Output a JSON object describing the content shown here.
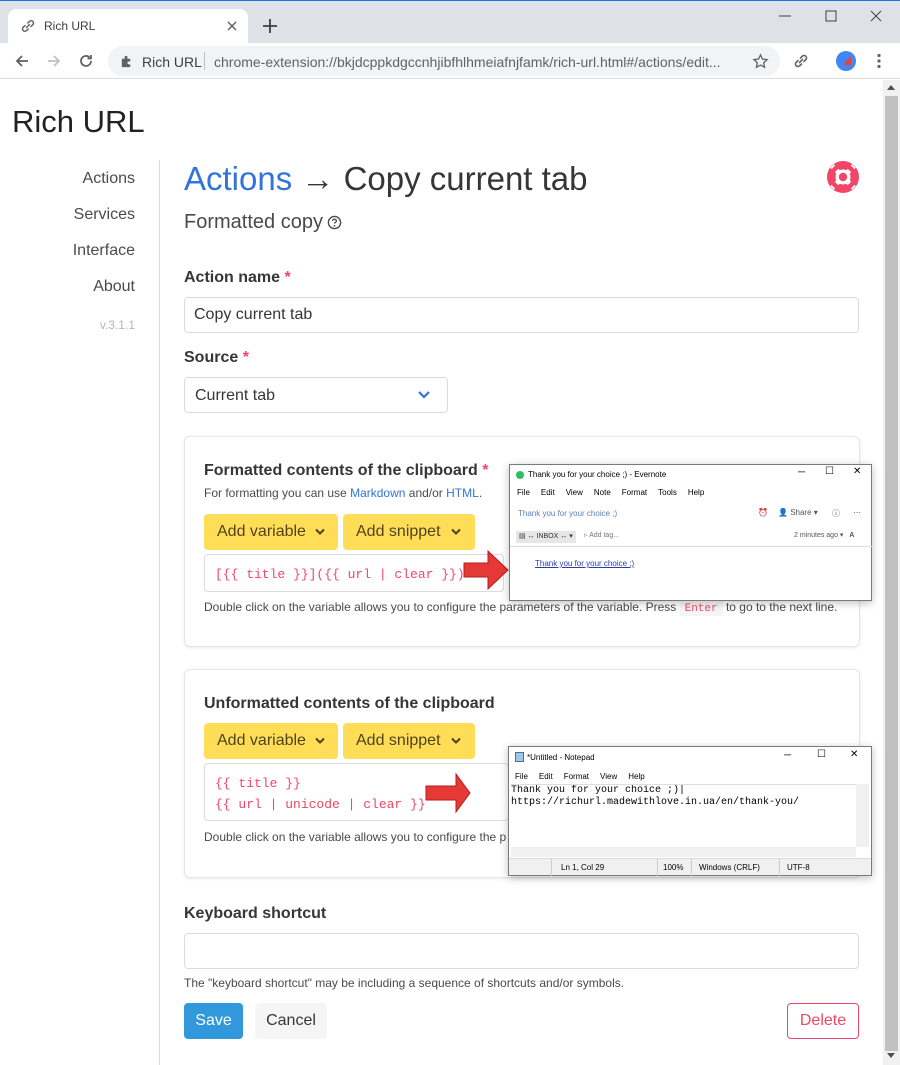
{
  "browser": {
    "tab_title": "Rich URL",
    "omnibox_name": "Rich URL",
    "omnibox_url": "chrome-extension://bkjdcppkdgccnhjibfhlhmeiafnjfamk/rich-url.html#/actions/edit..."
  },
  "brand": "Rich URL",
  "sidebar": {
    "items": [
      {
        "label": "Actions"
      },
      {
        "label": "Services"
      },
      {
        "label": "Interface"
      },
      {
        "label": "About"
      }
    ],
    "version": "v.3.1.1"
  },
  "header": {
    "title_link": "Actions",
    "title_arrow": " → ",
    "title_rest": "Copy current tab",
    "subtitle": "Formatted copy"
  },
  "form": {
    "action_name_label": "Action name",
    "action_name_value": "Copy current tab",
    "required_mark": "*",
    "source_label": "Source",
    "source_value": "Current tab",
    "formatted": {
      "title": "Formatted contents of the clipboard",
      "hint_prefix": "For formatting you can use ",
      "hint_markdown": "Markdown",
      "hint_mid": " and/or ",
      "hint_html": "HTML",
      "hint_suffix": ".",
      "add_variable": "Add variable",
      "add_snippet": "Add snippet",
      "code_lines": [
        "[{{ title }}]({{ url | clear }})"
      ],
      "bottom_hint_prefix": "Double click on the variable allows you to configure the parameters of the variable. Press ",
      "bottom_hint_key": "Enter",
      "bottom_hint_suffix": " to go to the next line."
    },
    "unformatted": {
      "title": "Unformatted contents of the clipboard",
      "add_variable": "Add variable",
      "add_snippet": "Add snippet",
      "code_lines": [
        "{{ title }}",
        "{{ url | unicode | clear }}"
      ],
      "bottom_hint": "Double click on the variable allows you to configure the p"
    },
    "shortcut_label": "Keyboard shortcut",
    "shortcut_value": "",
    "shortcut_hint": "The \"keyboard shortcut\" may be including a sequence of shortcuts and/or symbols.",
    "save": "Save",
    "cancel": "Cancel",
    "delete": "Delete"
  },
  "evernote": {
    "title": "Thank you for your choice ;) - Evernote",
    "menu": [
      "File",
      "Edit",
      "View",
      "Note",
      "Format",
      "Tools",
      "Help"
    ],
    "note_title": "Thank you for your choice ;)",
    "share": "Share",
    "notebook": "INBOX",
    "add_tag": "Add tag...",
    "ago": "2 minutes ago",
    "body_link": "Thank you for your choice ;)"
  },
  "notepad": {
    "title": "*Untitled - Notepad",
    "menu": [
      "File",
      "Edit",
      "Format",
      "View",
      "Help"
    ],
    "text": "Thank you for your choice ;)|\nhttps://richurl.madewithlove.in.ua/en/thank-you/",
    "status": {
      "position": "Ln 1, Col 29",
      "zoom": "100%",
      "eol": "Windows (CRLF)",
      "encoding": "UTF-8"
    }
  },
  "colors": {
    "link": "#3273dc",
    "danger": "#f14668",
    "warning": "#ffdd57",
    "info": "#3298dc",
    "arrow": "#e53935"
  }
}
